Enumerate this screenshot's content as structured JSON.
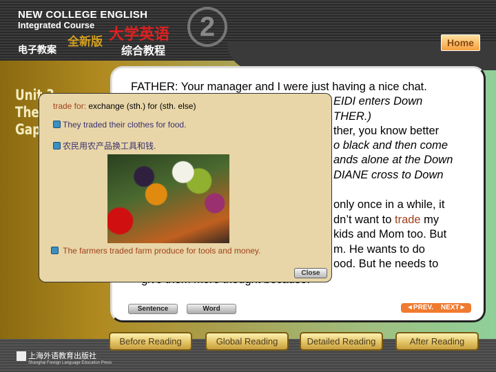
{
  "header": {
    "title_en": "NEW COLLEGE ENGLISH",
    "subtitle_en": "Integrated Course",
    "edition": "全新版",
    "title_cn": "大学英语",
    "label_left": "电子教案",
    "label_right": "综合教程",
    "volume": "2",
    "home": "Home"
  },
  "unit": {
    "line1": "Unit 3",
    "line2": "The",
    "line3": "Gap"
  },
  "script_lines": [
    "FATHER: Your manager and I were just having a nice chat.",
    "EIDI enters Down",
    "THER.)",
    "ther, you know better",
    "o black and then come",
    "ands alone at the Down",
    "DIANE cross to Down",
    "only once in a while, it",
    "dn’t want to ",
    "trade",
    " my",
    "kids and Mom too. But",
    "m. He wants to do",
    "ood. But he needs to",
    "give them more thought because."
  ],
  "popup": {
    "term": "trade for:",
    "definition": "exchange (sth.) for (sth. else)",
    "example_en": "They traded their clothes for food.",
    "example_cn": "农民用农产品换工具和钱.",
    "translation": "The farmers traded farm produce for tools and money.",
    "close": "Close"
  },
  "controls": {
    "sentence": "Sentence",
    "word": "Word",
    "prev": "◄PREV.",
    "next": "NEXT►"
  },
  "nav": [
    "Before Reading",
    "Global Reading",
    "Detailed Reading",
    "After Reading"
  ],
  "publisher": {
    "cn": "上海外语教育出版社",
    "en": "Shanghai Foreign Language Education Press"
  }
}
